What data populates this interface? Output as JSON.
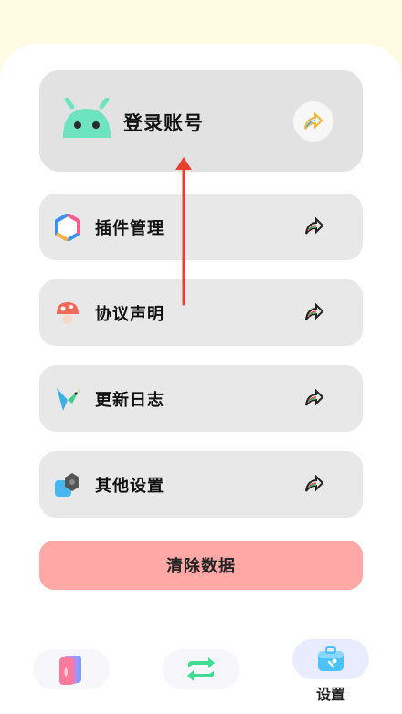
{
  "login": {
    "label": "登录账号"
  },
  "menu": {
    "items": [
      {
        "label": "插件管理",
        "icon": "plugin-icon"
      },
      {
        "label": "协议声明",
        "icon": "mushroom-icon"
      },
      {
        "label": "更新日志",
        "icon": "bird-icon"
      },
      {
        "label": "其他设置",
        "icon": "settings-cube-icon"
      }
    ]
  },
  "clear": {
    "label": "清除数据"
  },
  "nav": {
    "items": [
      {
        "icon": "cards-icon",
        "label": ""
      },
      {
        "icon": "swap-arrows-icon",
        "label": ""
      },
      {
        "icon": "toolbox-icon",
        "label": "设置"
      }
    ]
  },
  "colors": {
    "background": "#fffbe2",
    "card": "#e8e8e8",
    "clear_button": "#ffa8a5",
    "android_green": "#6ee3c0",
    "gesture_arrow": "#e8402e"
  }
}
